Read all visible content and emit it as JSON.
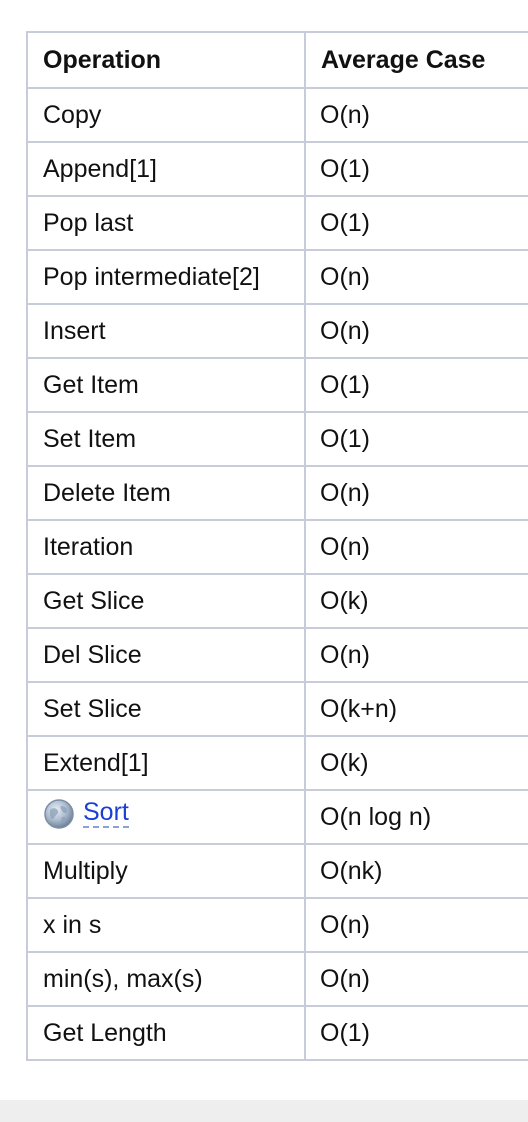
{
  "table": {
    "headers": {
      "operation": "Operation",
      "average_case": "Average Case"
    },
    "rows": [
      {
        "operation": "Copy",
        "average_case": "O(n)"
      },
      {
        "operation": "Append[1]",
        "average_case": "O(1)"
      },
      {
        "operation": "Pop last",
        "average_case": "O(1)"
      },
      {
        "operation": "Pop intermediate[2]",
        "average_case": "O(n)"
      },
      {
        "operation": "Insert",
        "average_case": "O(n)"
      },
      {
        "operation": "Get Item",
        "average_case": "O(1)"
      },
      {
        "operation": "Set Item",
        "average_case": "O(1)"
      },
      {
        "operation": "Delete Item",
        "average_case": "O(n)"
      },
      {
        "operation": "Iteration",
        "average_case": "O(n)"
      },
      {
        "operation": "Get Slice",
        "average_case": "O(k)"
      },
      {
        "operation": "Del Slice",
        "average_case": "O(n)"
      },
      {
        "operation": "Set Slice",
        "average_case": "O(k+n)"
      },
      {
        "operation": "Extend[1]",
        "average_case": "O(k)"
      },
      {
        "operation": "Sort",
        "average_case": "O(n log n)",
        "link": true,
        "icon": "globe-icon"
      },
      {
        "operation": "Multiply",
        "average_case": "O(nk)"
      },
      {
        "operation": "x in s",
        "average_case": "O(n)"
      },
      {
        "operation": "min(s), max(s)",
        "average_case": "O(n)"
      },
      {
        "operation": "Get Length",
        "average_case": "O(1)"
      }
    ]
  },
  "colors": {
    "border": "#c8ccd8",
    "link": "#1a3fd6",
    "text": "#111111"
  }
}
